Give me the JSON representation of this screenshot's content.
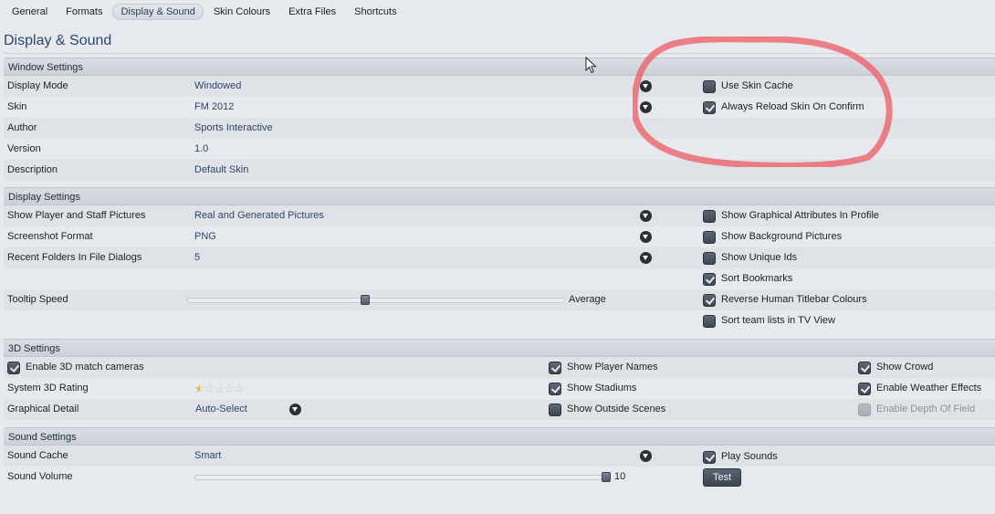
{
  "tabs": [
    {
      "label": "General",
      "active": false
    },
    {
      "label": "Formats",
      "active": false
    },
    {
      "label": "Display & Sound",
      "active": true
    },
    {
      "label": "Skin Colours",
      "active": false
    },
    {
      "label": "Extra Files",
      "active": false
    },
    {
      "label": "Shortcuts",
      "active": false
    }
  ],
  "page_title": "Display & Sound",
  "window_settings": {
    "header": "Window Settings",
    "rows": [
      {
        "label": "Display Mode",
        "value": "Windowed",
        "dropdown": true
      },
      {
        "label": "Skin",
        "value": "FM 2012",
        "dropdown": true
      },
      {
        "label": "Author",
        "value": "Sports Interactive"
      },
      {
        "label": "Version",
        "value": "1.0"
      },
      {
        "label": "Description",
        "value": "Default Skin"
      }
    ],
    "checkboxes": [
      {
        "label": "Use Skin Cache",
        "checked": false
      },
      {
        "label": "Always Reload Skin On Confirm",
        "checked": true
      }
    ]
  },
  "display_settings": {
    "header": "Display Settings",
    "rows": [
      {
        "label": "Show Player and Staff Pictures",
        "value": "Real and Generated Pictures",
        "dropdown": true
      },
      {
        "label": "Screenshot Format",
        "value": "PNG",
        "dropdown": true
      },
      {
        "label": "Recent Folders In File Dialogs",
        "value": "5",
        "dropdown": true
      }
    ],
    "tooltip_speed": {
      "label": "Tooltip Speed",
      "value_label": "Average",
      "fraction": 0.47
    },
    "checkboxes": [
      {
        "label": "Show Graphical Attributes In Profile",
        "checked": false
      },
      {
        "label": "Show Background Pictures",
        "checked": false
      },
      {
        "label": "Show Unique Ids",
        "checked": false
      },
      {
        "label": "Sort Bookmarks",
        "checked": true
      },
      {
        "label": "Reverse Human Titlebar Colours",
        "checked": true
      },
      {
        "label": "Sort team lists in TV View",
        "checked": false
      }
    ]
  },
  "settings_3d": {
    "header": "3D Settings",
    "enable_cameras": {
      "label": "Enable 3D match cameras",
      "checked": true
    },
    "rating": {
      "label": "System 3D Rating",
      "stars": 0.5,
      "max": 5
    },
    "graphical_detail": {
      "label": "Graphical Detail",
      "value": "Auto-Select"
    },
    "middle_checkboxes": [
      {
        "label": "Show Player Names",
        "checked": true
      },
      {
        "label": "Show Stadiums",
        "checked": true
      },
      {
        "label": "Show Outside Scenes",
        "checked": false
      }
    ],
    "right_checkboxes": [
      {
        "label": "Show Crowd",
        "checked": true,
        "disabled": false
      },
      {
        "label": "Enable Weather Effects",
        "checked": true,
        "disabled": false
      },
      {
        "label": "Enable Depth Of Field",
        "checked": false,
        "disabled": true
      }
    ]
  },
  "sound_settings": {
    "header": "Sound Settings",
    "sound_cache": {
      "label": "Sound Cache",
      "value": "Smart"
    },
    "sound_volume": {
      "label": "Sound Volume",
      "value": "10",
      "fraction": 1.0
    },
    "play_sounds": {
      "label": "Play Sounds",
      "checked": true
    },
    "test_button": "Test"
  },
  "annotation": {
    "color": "#ee5a63",
    "shape": "hand-drawn ellipse around skin checkboxes"
  }
}
